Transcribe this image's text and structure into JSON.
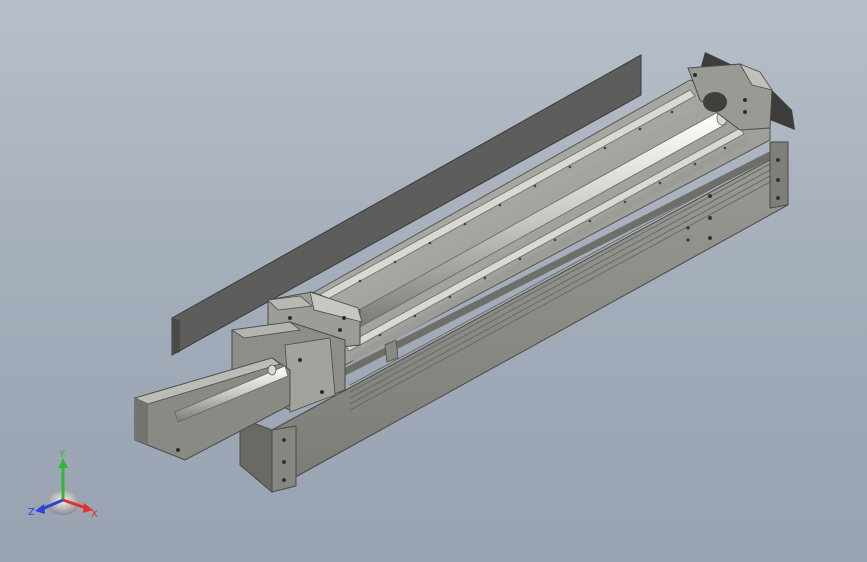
{
  "viewport": {
    "background_top": "#b7bfca",
    "background_bottom": "#98a2b1"
  },
  "model": {
    "frame_color": "#8a8a84",
    "frame_dark": "#555551",
    "plate_color": "#5d5d5b",
    "rail_color": "#c9c9c3",
    "shaft_color": "#e4e4de"
  },
  "triad": {
    "x_label": "X",
    "y_label": "Y",
    "z_label": "Z",
    "x_color": "#e0312a",
    "y_color": "#2fb934",
    "z_color": "#2c44d8"
  }
}
